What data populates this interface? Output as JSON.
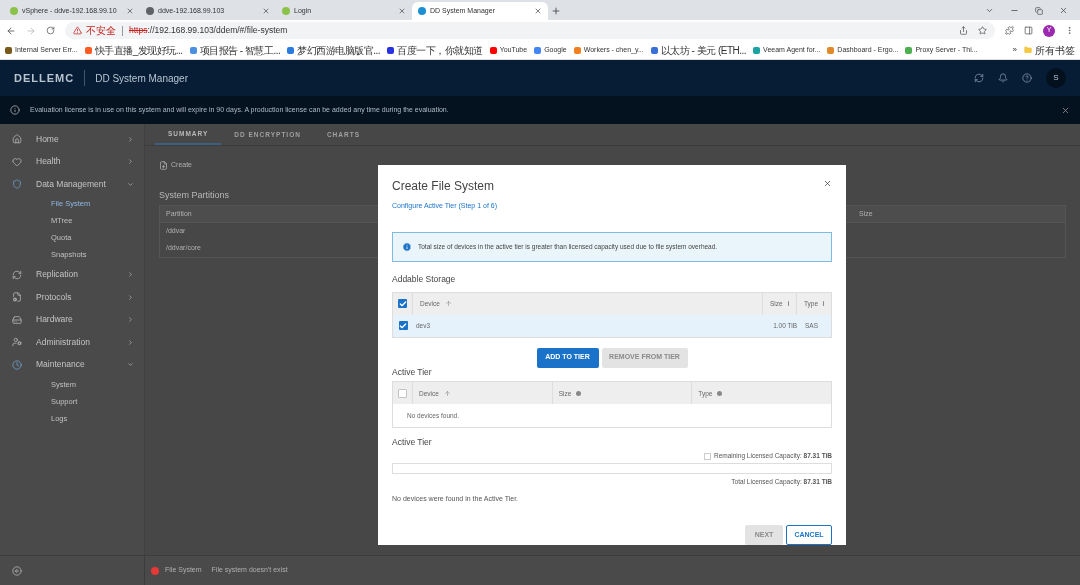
{
  "browser": {
    "tabs": [
      {
        "title": "vSphere - ddve-192.168.99.10",
        "selected": false,
        "color": "#8bc34a"
      },
      {
        "title": "ddve-192.168.99.103",
        "selected": false,
        "color": "#5f6368"
      },
      {
        "title": "Login",
        "selected": false,
        "color": "#8bc34a"
      },
      {
        "title": "DD System Manager",
        "selected": true,
        "color": "#1a8fd1"
      }
    ],
    "address": {
      "warning": "不安全",
      "scheme": "https",
      "rest": "://192.168.99.103/ddem/#/file-system"
    },
    "profile": "Y",
    "bookmarks": [
      {
        "title": "Internal Server Err...",
        "color": "#7a5a1a"
      },
      {
        "title": "快手直播_发现好玩...",
        "color": "#ff5a1f"
      },
      {
        "title": "项目报告 - 智慧工...",
        "color": "#4a8fe0"
      },
      {
        "title": "梦幻西游电脑版官...",
        "color": "#2a7be0"
      },
      {
        "title": "百度一下，你就知道",
        "color": "#2932e1"
      },
      {
        "title": "YouTube",
        "color": "#ff0000"
      },
      {
        "title": "Google",
        "color": "#4285f4"
      },
      {
        "title": "Workers - chen_y...",
        "color": "#f38020"
      },
      {
        "title": "以太坊 - 美元 (ETH...",
        "color": "#3a6fd8"
      },
      {
        "title": "Veeam Agent for...",
        "color": "#1aa3a3"
      },
      {
        "title": "Dashboard - Ergo...",
        "color": "#e08a2a"
      },
      {
        "title": "Proxy Server - Thi...",
        "color": "#4caf50"
      }
    ],
    "more": "»",
    "all_bookmarks": "所有书签"
  },
  "app": {
    "brand": "DELLEMC",
    "product": "DD System Manager",
    "user": "S",
    "notice": "Evaluation license is in use on this system and will expire in 90 days. A production license can be added any time during the evaluation.",
    "sidebar": [
      {
        "label": "Home",
        "expanded": false
      },
      {
        "label": "Health",
        "expanded": false
      },
      {
        "label": "Data Management",
        "expanded": true,
        "children": [
          {
            "label": "File System",
            "selected": true
          },
          {
            "label": "MTree",
            "selected": false
          },
          {
            "label": "Quota",
            "selected": false
          },
          {
            "label": "Snapshots",
            "selected": false
          }
        ]
      },
      {
        "label": "Replication",
        "expanded": false
      },
      {
        "label": "Protocols",
        "expanded": false
      },
      {
        "label": "Hardware",
        "expanded": false
      },
      {
        "label": "Administration",
        "expanded": false
      },
      {
        "label": "Maintenance",
        "expanded": true,
        "children": [
          {
            "label": "System",
            "selected": false
          },
          {
            "label": "Support",
            "selected": false
          },
          {
            "label": "Logs",
            "selected": false
          }
        ]
      }
    ],
    "tabs": [
      {
        "label": "SUMMARY",
        "selected": true
      },
      {
        "label": "DD ENCRYPTION",
        "selected": false
      },
      {
        "label": "CHARTS",
        "selected": false
      }
    ],
    "create": "Create",
    "partitions_title": "System Partitions",
    "partitions": {
      "columns": [
        "Partition",
        "Size"
      ],
      "rows": [
        "/ddvar",
        "/ddvar/core"
      ]
    },
    "status": {
      "label": "File System",
      "message": "File system doesn't exist",
      "color": "#e53935"
    }
  },
  "dialog": {
    "title": "Create File System",
    "step": "Configure Active Tier (Step 1 of 6)",
    "info": "Total size of devices in the active tier is greater than licensed capacity used due to file system overhead.",
    "addable_title": "Addable Storage",
    "all_checked": true,
    "addable_columns": [
      "Device",
      "Size",
      "Type"
    ],
    "addable_rows": [
      {
        "device": "dev3",
        "size": "1.00 TiB",
        "type": "SAS",
        "checked": true
      }
    ],
    "add": {
      "label": "ADD TO TIER",
      "disabled": false
    },
    "remove": {
      "label": "REMOVE FROM TIER",
      "disabled": true
    },
    "tier_title": "Active Tier",
    "tier_all_checked": false,
    "tier_columns": [
      "Device",
      "Size",
      "Type"
    ],
    "tier_empty": "No devices found.",
    "capacity_title": "Active Tier",
    "remaining": "Remaining Licensed Capacity: **87.31 TiB**",
    "level": 0,
    "total": "Total Licensed Capacity: **87.31 TiB**",
    "no_devices": "No devices were found in the Active Tier.",
    "next": {
      "label": "NEXT",
      "disabled": true
    },
    "cancel": {
      "label": "CANCEL",
      "disabled": false
    }
  }
}
